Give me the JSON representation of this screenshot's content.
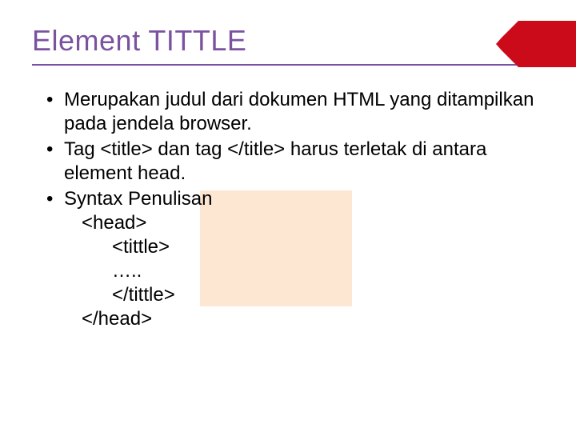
{
  "title": "Element TITTLE",
  "bullets": {
    "b1": "Merupakan judul dari dokumen HTML yang ditampilkan pada jendela browser.",
    "b2": "Tag <title> dan tag </title> harus terletak di antara element head.",
    "b3": "Syntax Penulisan"
  },
  "code": {
    "l1": "<head>",
    "l2": "<tittle>",
    "l3": "…..",
    "l4": "</tittle>",
    "l5": "</head>"
  },
  "colors": {
    "title": "#7a52a0",
    "accent_bg": "#fde7d3",
    "logo": "#cc0b1a"
  }
}
